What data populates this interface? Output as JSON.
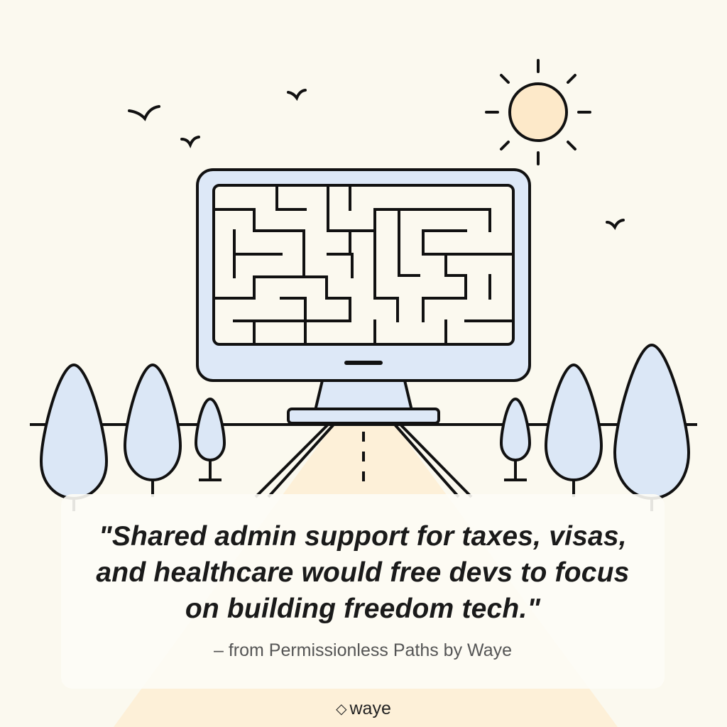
{
  "quote": {
    "lines": [
      "\"Shared admin support for taxes, visas,",
      "and healthcare would free devs to focus",
      "on building freedom tech.\""
    ],
    "attribution": "– from Permissionless Paths by Waye"
  },
  "brand": {
    "icon": "diamond-outline-icon",
    "name": "waye"
  },
  "colors": {
    "background": "#fbf9ef",
    "outline": "#111111",
    "tree_fill": "#dbe7f6",
    "monitor_fill": "#dde8f7",
    "sun_fill": "#fde9c9",
    "road_fill": "#fdf0d8"
  }
}
